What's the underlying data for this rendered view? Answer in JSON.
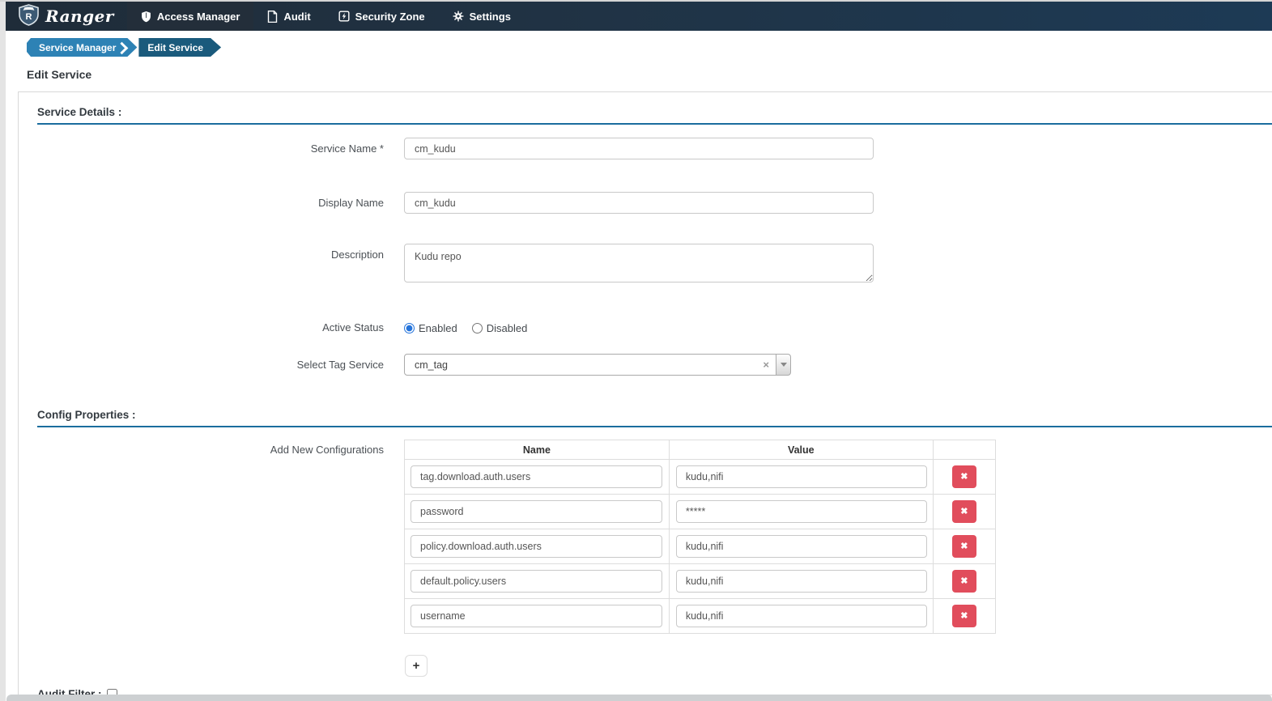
{
  "navbar": {
    "brand": "Ranger",
    "items": [
      {
        "label": "Access Manager",
        "icon": "shield-icon",
        "active": true
      },
      {
        "label": "Audit",
        "icon": "document-icon",
        "active": false
      },
      {
        "label": "Security Zone",
        "icon": "zone-bolt-icon",
        "active": false
      },
      {
        "label": "Settings",
        "icon": "gear-icon",
        "active": false
      }
    ]
  },
  "breadcrumb": {
    "items": [
      {
        "label": "Service Manager"
      },
      {
        "label": "Edit Service"
      }
    ]
  },
  "page": {
    "title": "Edit Service"
  },
  "service_details": {
    "section_title": "Service Details :",
    "fields": {
      "service_name": {
        "label": "Service Name *",
        "value": "cm_kudu"
      },
      "display_name": {
        "label": "Display Name",
        "value": "cm_kudu"
      },
      "description": {
        "label": "Description",
        "value": "Kudu repo"
      },
      "active_status": {
        "label": "Active Status",
        "options": [
          "Enabled",
          "Disabled"
        ],
        "selected": "Enabled"
      },
      "tag_service": {
        "label": "Select Tag Service",
        "value": "cm_tag"
      }
    }
  },
  "config_properties": {
    "section_title": "Config Properties :",
    "add_label": "Add New Configurations",
    "columns": [
      "Name",
      "Value"
    ],
    "rows": [
      {
        "name": "tag.download.auth.users",
        "value": "kudu,nifi"
      },
      {
        "name": "password",
        "value": "*****"
      },
      {
        "name": "policy.download.auth.users",
        "value": "kudu,nifi"
      },
      {
        "name": "default.policy.users",
        "value": "kudu,nifi"
      },
      {
        "name": "username",
        "value": "kudu,nifi"
      }
    ]
  },
  "audit_filter": {
    "label": "Audit Filter :",
    "checked": false
  },
  "icons": {
    "delete": "✖",
    "plus": "+",
    "clear": "×"
  },
  "colors": {
    "navbar_bg": "#1f2c39",
    "navbar_active_bg": "#232e3a",
    "breadcrumb_primary": "#2d82b5",
    "breadcrumb_secondary": "#1a5a7c",
    "section_rule": "#1b6d9e",
    "danger": "#e14d5c",
    "radio_accent": "#2574db"
  }
}
